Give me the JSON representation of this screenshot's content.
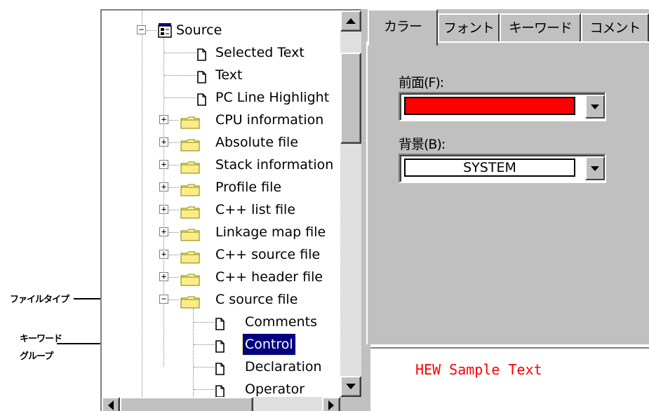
{
  "annotations": {
    "file_type": "ファイルタイプ",
    "keyword_group_line1": "キーワード",
    "keyword_group_line2": "グループ"
  },
  "tree": {
    "root_label": "Source",
    "items": [
      {
        "label": "Selected Text",
        "kind": "doc"
      },
      {
        "label": "Text",
        "kind": "doc"
      },
      {
        "label": "PC Line Highlight",
        "kind": "doc"
      },
      {
        "label": "CPU information",
        "kind": "folder",
        "expander": "+"
      },
      {
        "label": "Absolute file",
        "kind": "folder",
        "expander": "+"
      },
      {
        "label": "Stack information",
        "kind": "folder",
        "expander": "+"
      },
      {
        "label": "Profile file",
        "kind": "folder",
        "expander": "+"
      },
      {
        "label": "C++ list file",
        "kind": "folder",
        "expander": "+"
      },
      {
        "label": "Linkage map file",
        "kind": "folder",
        "expander": "+"
      },
      {
        "label": "C++ source file",
        "kind": "folder",
        "expander": "+"
      },
      {
        "label": "C++ header file",
        "kind": "folder",
        "expander": "+"
      },
      {
        "label": "C source file",
        "kind": "folder",
        "expander": "−"
      }
    ],
    "children": [
      {
        "label": "Comments"
      },
      {
        "label": "Control",
        "selected": true
      },
      {
        "label": "Declaration"
      },
      {
        "label": "Operator"
      }
    ],
    "root_expander": "−"
  },
  "tabs": [
    {
      "label": "カラー",
      "active": true
    },
    {
      "label": "フォント"
    },
    {
      "label": "キーワード"
    },
    {
      "label": "コメント"
    }
  ],
  "color_tab": {
    "foreground_label": "前面(F):",
    "foreground_value_color": "#ff0000",
    "background_label": "背景(B):",
    "background_value": "SYSTEM"
  },
  "preview": {
    "text": "HEW Sample Text",
    "text_color": "#ff0000"
  },
  "colors": {
    "selection": "#000080",
    "panel": "#c0c0c0",
    "folder": "#ffff99"
  }
}
